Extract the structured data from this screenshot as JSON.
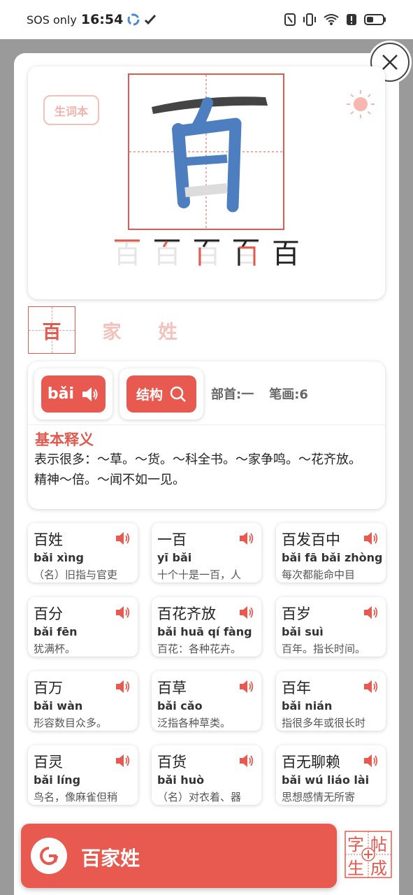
{
  "status": {
    "carrier": "SOS only",
    "time": "16:54"
  },
  "header": {
    "vocab_label": "生词本"
  },
  "character": {
    "main": "百",
    "stroke_sequence": [
      "百",
      "百",
      "百",
      "百",
      "百"
    ]
  },
  "tabs": [
    {
      "label": "百",
      "active": true
    },
    {
      "label": "家",
      "active": false
    },
    {
      "label": "姓",
      "active": false
    }
  ],
  "info": {
    "pinyin": "bǎi",
    "structure_label": "结构",
    "radical": "部首:一",
    "strokes": "笔画:6",
    "def_title": "基本释义",
    "def_text": "表示很多：～草。～货。～科全书。～家争鸣。～花齐放。精神～倍。～闻不如一见。"
  },
  "words": [
    {
      "word": "百姓",
      "pinyin": "bǎi xìng",
      "desc": "（名）旧指与官吏"
    },
    {
      "word": "一百",
      "pinyin": "yī bǎi",
      "desc": "十个十是一百，人"
    },
    {
      "word": "百发百中",
      "pinyin": "bǎi fā bǎi zhòng",
      "desc": "每次都能命中目"
    },
    {
      "word": "百分",
      "pinyin": "bǎi fēn",
      "desc": "犹满杯。"
    },
    {
      "word": "百花齐放",
      "pinyin": "bǎi huā qí fàng",
      "desc": "百花：各种花卉。"
    },
    {
      "word": "百岁",
      "pinyin": "bǎi suì",
      "desc": "百年。指长时间。"
    },
    {
      "word": "百万",
      "pinyin": "bǎi wàn",
      "desc": "形容数目众多。"
    },
    {
      "word": "百草",
      "pinyin": "bǎi cǎo",
      "desc": "泛指各种草类。"
    },
    {
      "word": "百年",
      "pinyin": "bǎi nián",
      "desc": "指很多年或很长时"
    },
    {
      "word": "百灵",
      "pinyin": "bǎi líng",
      "desc": "鸟名，像麻雀但稍"
    },
    {
      "word": "百货",
      "pinyin": "bǎi huò",
      "desc": "（名）对衣着、器"
    },
    {
      "word": "百无聊赖",
      "pinyin": "bǎi wú liáo lài",
      "desc": "思想感情无所寄"
    }
  ],
  "bottom": {
    "title": "百家姓"
  },
  "generator": {
    "chars": [
      "字",
      "帖",
      "生",
      "成"
    ]
  },
  "colors": {
    "accent": "#e85a4f",
    "accent_light": "#f4c2bd"
  },
  "icons": [
    "close-icon",
    "sun-icon",
    "speaker-icon",
    "search-icon",
    "refresh-icon"
  ]
}
